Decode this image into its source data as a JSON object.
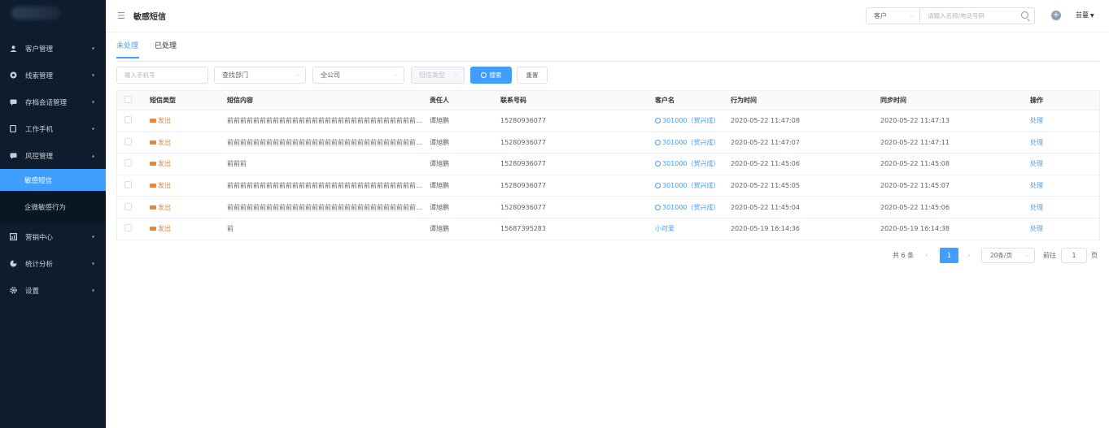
{
  "header": {
    "page_title": "敏感短信",
    "search_type": "客户",
    "search_placeholder": "请输入名称/电话号码",
    "user_name": "芸蔓"
  },
  "sidebar": {
    "items": [
      {
        "label": "客户管理",
        "icon": "user-icon",
        "arrow": "▾"
      },
      {
        "label": "线索管理",
        "icon": "target-icon",
        "arrow": "▾"
      },
      {
        "label": "存档会话管理",
        "icon": "chat-icon",
        "arrow": "▾"
      },
      {
        "label": "工作手机",
        "icon": "phone-icon",
        "arrow": "▾"
      },
      {
        "label": "风控管理",
        "icon": "shield-icon",
        "arrow": "▴"
      }
    ],
    "sub_items": [
      {
        "label": "敏感短信"
      },
      {
        "label": "企微敏感行为"
      }
    ],
    "items_after": [
      {
        "label": "营销中心",
        "icon": "chart-icon",
        "arrow": "▾"
      },
      {
        "label": "统计分析",
        "icon": "pie-icon",
        "arrow": "▾"
      },
      {
        "label": "设置",
        "icon": "gear-icon",
        "arrow": "▾"
      }
    ]
  },
  "tabs": [
    {
      "label": "未处理",
      "active": true
    },
    {
      "label": "已处理",
      "active": false
    }
  ],
  "filters": {
    "phone_placeholder": "输入手机号",
    "dept_placeholder": "查找部门",
    "company_value": "全公司",
    "sms_type_placeholder": "短信类型",
    "search_label": "搜索",
    "reset_label": "重置"
  },
  "table": {
    "columns": [
      "短信类型",
      "短信内容",
      "责任人",
      "联系号码",
      "客户名",
      "行为时间",
      "同步时间",
      "操作"
    ],
    "rows": [
      {
        "type": "发出",
        "content": "前前前前前前前前前前前前前前前前前前前前前前前前前前前前前前前前...",
        "owner": "谭旭鹏",
        "phone": "15280936077",
        "customer": "301000（贺兴成）",
        "action_time": "2020-05-22 11:47:08",
        "sync_time": "2020-05-22 11:47:13",
        "op": "处理"
      },
      {
        "type": "发出",
        "content": "前前前前前前前前前前前前前前前前前前前前前前前前前前前前前前前前...",
        "owner": "谭旭鹏",
        "phone": "15280936077",
        "customer": "301000（贺兴成）",
        "action_time": "2020-05-22 11:47:07",
        "sync_time": "2020-05-22 11:47:11",
        "op": "处理"
      },
      {
        "type": "发出",
        "content": "前前前",
        "owner": "谭旭鹏",
        "phone": "15280936077",
        "customer": "301000（贺兴成）",
        "action_time": "2020-05-22 11:45:06",
        "sync_time": "2020-05-22 11:45:08",
        "op": "处理"
      },
      {
        "type": "发出",
        "content": "前前前前前前前前前前前前前前前前前前前前前前前前前前前前前前前前...",
        "owner": "谭旭鹏",
        "phone": "15280936077",
        "customer": "301000（贺兴成）",
        "action_time": "2020-05-22 11:45:05",
        "sync_time": "2020-05-22 11:45:07",
        "op": "处理"
      },
      {
        "type": "发出",
        "content": "前前前前前前前前前前前前前前前前前前前前前前前前前前前前前前前前...",
        "owner": "谭旭鹏",
        "phone": "15280936077",
        "customer": "301000（贺兴成）",
        "action_time": "2020-05-22 11:45:04",
        "sync_time": "2020-05-22 11:45:06",
        "op": "处理"
      },
      {
        "type": "发出",
        "content": "前",
        "owner": "谭旭鹏",
        "phone": "15687395283",
        "customer": "小可爱",
        "action_time": "2020-05-19 16:14:36",
        "sync_time": "2020-05-19 16:14:38",
        "op": "处理"
      }
    ]
  },
  "pagination": {
    "total": "共 6 条",
    "prev": "‹",
    "current_page": "1",
    "next": "›",
    "page_size": "20条/页",
    "goto_label": "前往",
    "goto_value": "1",
    "goto_unit": "页"
  },
  "colors": {
    "primary": "#409eff",
    "sidebar_bg": "#0f1c2d",
    "tag_orange": "#e6873d"
  }
}
